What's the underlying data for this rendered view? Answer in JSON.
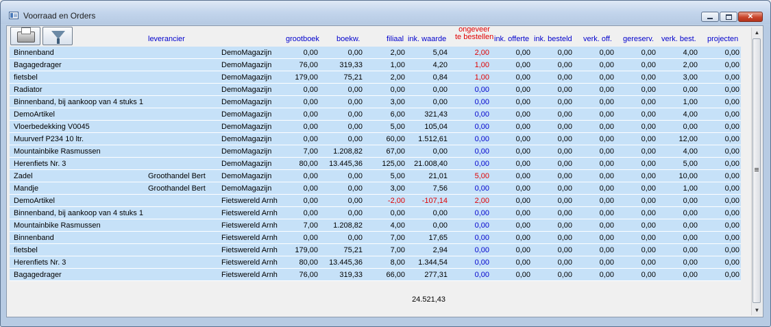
{
  "window": {
    "title": "Voorraad en Orders"
  },
  "toolbar": {
    "print_icon": "printer-icon",
    "filter_icon": "funnel-icon"
  },
  "headers": {
    "leverancier": "leverancier",
    "grootboek": "grootboek",
    "boekw": "boekw.",
    "filiaal": "filiaal",
    "ink_waarde": "ink. waarde",
    "ongeveer_1": "ongeveer",
    "ongeveer_2": "te bestellen",
    "ink_offerte": "ink. offerte",
    "ink_besteld": "ink. besteld",
    "verk_off": "verk. off.",
    "gereserv": "gereserv.",
    "verk_best": "verk. best.",
    "projecten": "projecten"
  },
  "colors": {
    "header": "#0000cc",
    "negative": "#e00000",
    "row_bg": "#c6e1f8"
  },
  "rows": [
    [
      "Binnenband",
      "",
      "DemoMagazijn",
      "0,00",
      "0,00",
      "2,00",
      "5,04",
      "2,00",
      "0,00",
      "0,00",
      "0,00",
      "0,00",
      "4,00",
      "0,00"
    ],
    [
      "Bagagedrager",
      "",
      "DemoMagazijn",
      "76,00",
      "319,33",
      "1,00",
      "4,20",
      "1,00",
      "0,00",
      "0,00",
      "0,00",
      "0,00",
      "2,00",
      "0,00"
    ],
    [
      "fietsbel",
      "",
      "DemoMagazijn",
      "179,00",
      "75,21",
      "2,00",
      "0,84",
      "1,00",
      "0,00",
      "0,00",
      "0,00",
      "0,00",
      "3,00",
      "0,00"
    ],
    [
      "Radiator",
      "",
      "DemoMagazijn",
      "0,00",
      "0,00",
      "0,00",
      "0,00",
      "0,00",
      "0,00",
      "0,00",
      "0,00",
      "0,00",
      "0,00",
      "0,00"
    ],
    [
      "Binnenband, bij aankoop van 4 stuks 1",
      "",
      "DemoMagazijn",
      "0,00",
      "0,00",
      "3,00",
      "0,00",
      "0,00",
      "0,00",
      "0,00",
      "0,00",
      "0,00",
      "1,00",
      "0,00"
    ],
    [
      "DemoArtikel",
      "",
      "DemoMagazijn",
      "0,00",
      "0,00",
      "6,00",
      "321,43",
      "0,00",
      "0,00",
      "0,00",
      "0,00",
      "0,00",
      "4,00",
      "0,00"
    ],
    [
      "Vloerbedekking V0045",
      "",
      "DemoMagazijn",
      "0,00",
      "0,00",
      "5,00",
      "105,04",
      "0,00",
      "0,00",
      "0,00",
      "0,00",
      "0,00",
      "0,00",
      "0,00"
    ],
    [
      "Muurverf P234 10 ltr.",
      "",
      "DemoMagazijn",
      "0,00",
      "0,00",
      "60,00",
      "1.512,61",
      "0,00",
      "0,00",
      "0,00",
      "0,00",
      "0,00",
      "12,00",
      "0,00"
    ],
    [
      "Mountainbike Rasmussen",
      "",
      "DemoMagazijn",
      "7,00",
      "1.208,82",
      "67,00",
      "0,00",
      "0,00",
      "0,00",
      "0,00",
      "0,00",
      "0,00",
      "4,00",
      "0,00"
    ],
    [
      "Herenfiets Nr. 3",
      "",
      "DemoMagazijn",
      "80,00",
      "13.445,36",
      "125,00",
      "21.008,40",
      "0,00",
      "0,00",
      "0,00",
      "0,00",
      "0,00",
      "5,00",
      "0,00"
    ],
    [
      "Zadel",
      "Groothandel Bert",
      "DemoMagazijn",
      "0,00",
      "0,00",
      "5,00",
      "21,01",
      "5,00",
      "0,00",
      "0,00",
      "0,00",
      "0,00",
      "10,00",
      "0,00"
    ],
    [
      "Mandje",
      "Groothandel Bert",
      "DemoMagazijn",
      "0,00",
      "0,00",
      "3,00",
      "7,56",
      "0,00",
      "0,00",
      "0,00",
      "0,00",
      "0,00",
      "1,00",
      "0,00"
    ],
    [
      "DemoArtikel",
      "",
      "Fietswereld Arnhem",
      "0,00",
      "0,00",
      "-2,00",
      "-107,14",
      "2,00",
      "0,00",
      "0,00",
      "0,00",
      "0,00",
      "0,00",
      "0,00"
    ],
    [
      "Binnenband, bij aankoop van 4 stuks 1",
      "",
      "Fietswereld Arnhem",
      "0,00",
      "0,00",
      "0,00",
      "0,00",
      "0,00",
      "0,00",
      "0,00",
      "0,00",
      "0,00",
      "0,00",
      "0,00"
    ],
    [
      "Mountainbike Rasmussen",
      "",
      "Fietswereld Arnhem",
      "7,00",
      "1.208,82",
      "4,00",
      "0,00",
      "0,00",
      "0,00",
      "0,00",
      "0,00",
      "0,00",
      "0,00",
      "0,00"
    ],
    [
      "Binnenband",
      "",
      "Fietswereld Arnhem",
      "0,00",
      "0,00",
      "7,00",
      "17,65",
      "0,00",
      "0,00",
      "0,00",
      "0,00",
      "0,00",
      "0,00",
      "0,00"
    ],
    [
      "fietsbel",
      "",
      "Fietswereld Arnhem",
      "179,00",
      "75,21",
      "7,00",
      "2,94",
      "0,00",
      "0,00",
      "0,00",
      "0,00",
      "0,00",
      "0,00",
      "0,00"
    ],
    [
      "Herenfiets Nr. 3",
      "",
      "Fietswereld Arnhem",
      "80,00",
      "13.445,36",
      "8,00",
      "1.344,54",
      "0,00",
      "0,00",
      "0,00",
      "0,00",
      "0,00",
      "0,00",
      "0,00"
    ],
    [
      "Bagagedrager",
      "",
      "Fietswereld Arnhem",
      "76,00",
      "319,33",
      "66,00",
      "277,31",
      "0,00",
      "0,00",
      "0,00",
      "0,00",
      "0,00",
      "0,00",
      "0,00"
    ]
  ],
  "total": "24.521,43"
}
